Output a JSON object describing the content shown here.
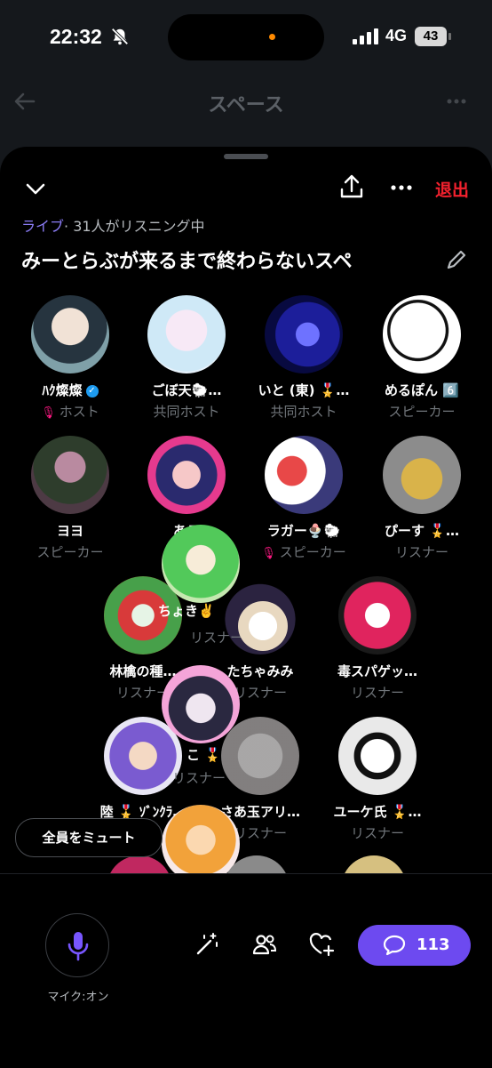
{
  "status_bar": {
    "time": "22:32",
    "network": "4G",
    "battery": "43"
  },
  "background_header": {
    "title": "スペース"
  },
  "space": {
    "live_label": "ライブ",
    "listening": "· 31人がリスニング中",
    "title": "みーとらぶが来るまで終わらないスペ",
    "leave_label": "退出"
  },
  "participants": [
    {
      "name": "ﾊｸ燦燦",
      "role": "ホスト",
      "verified": true,
      "mic_off": true
    },
    {
      "name": "ごぼ天🐑…",
      "role": "共同ホスト"
    },
    {
      "name": "いと (東) 🎖️…",
      "role": "共同ホスト"
    },
    {
      "name": "めるぽん 6️⃣",
      "role": "スピーカー"
    },
    {
      "name": "ヨヨ",
      "role": "スピーカー"
    },
    {
      "name": "あろ",
      "role": "ス"
    },
    {
      "name": "ラガー🍨🐑",
      "role": "スピーカー",
      "mic_off": true
    },
    {
      "name": "ぴーす 🎖️…",
      "role": "リスナー"
    },
    {
      "name": "林檎の種…",
      "role": "リスナー"
    },
    {
      "name": "たちゃみみ",
      "role": "リスナー"
    },
    {
      "name": "毒スパゲッ…",
      "role": "リスナー"
    },
    {
      "name": "陸 🎖️ ｿﾞﾝｸﾗ…",
      "role": ""
    },
    {
      "name": "さあ玉アリ…",
      "role": "リスナー"
    },
    {
      "name": "ユーケ氏 🎖️…",
      "role": "リスナー"
    }
  ],
  "floating_labels": {
    "chokki": "ちょき✌️",
    "listener1": "リスナー",
    "ko": "こ 🎖️",
    "listener2": "リスナー"
  },
  "controls": {
    "mute_all": "全員をミュート",
    "mic_label": "マイク:オン",
    "reply_count": "113"
  },
  "colors": {
    "accent": "#6d4af0",
    "leave": "#f4212e",
    "live": "#8b7cf6",
    "muted_icon": "#f91880"
  }
}
